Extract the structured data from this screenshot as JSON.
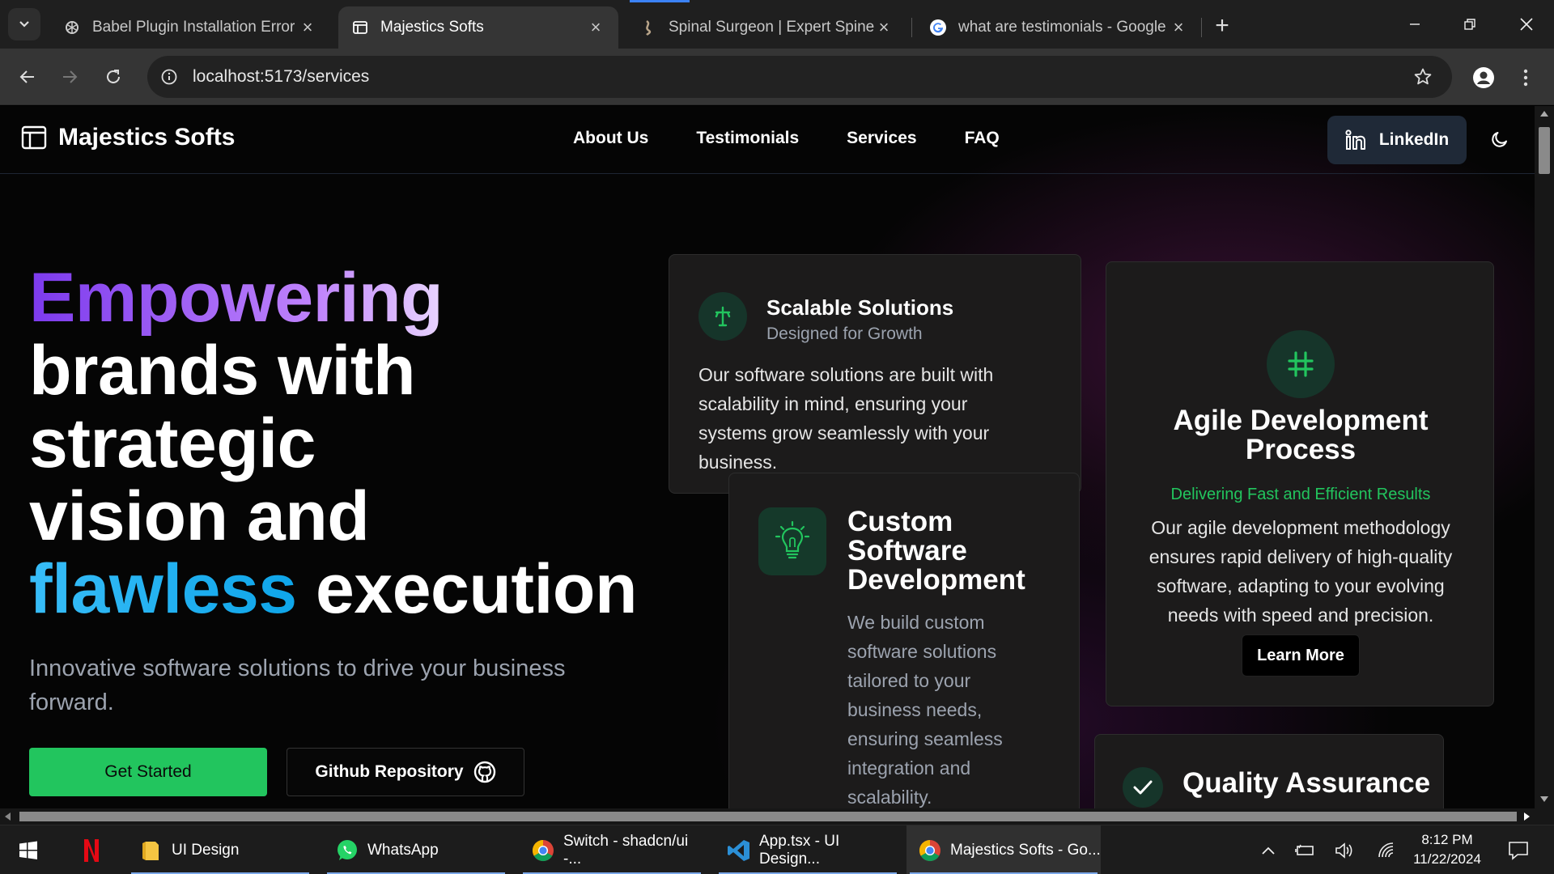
{
  "browser": {
    "tabs": [
      {
        "title": "Babel Plugin Installation Error",
        "icon": "openai-icon",
        "active": false
      },
      {
        "title": "Majestics Softs",
        "icon": "layout-icon",
        "active": true
      },
      {
        "title": "Spinal Surgeon | Expert Spine C",
        "icon": "spine-icon",
        "active": false
      },
      {
        "title": "what are testimonials - Google",
        "icon": "google-icon",
        "active": false
      }
    ],
    "url": "localhost:5173/services"
  },
  "site": {
    "brand": "Majestics Softs",
    "nav": [
      "About Us",
      "Testimonials",
      "Services",
      "FAQ"
    ],
    "linkedin_label": "LinkedIn"
  },
  "hero": {
    "line1": "Empowering",
    "line2": "brands with",
    "line3": "strategic",
    "line4": "vision and",
    "line5_highlight": "flawless",
    "line5_rest": " execution",
    "subtitle": "Innovative software solutions to drive your business forward.",
    "primary_button": "Get Started",
    "secondary_button": "Github Repository"
  },
  "cards": {
    "scalable": {
      "title": "Scalable Solutions",
      "subtitle": "Designed for Growth",
      "body": "Our software solutions are built with scalability in mind, ensuring your systems grow seamlessly with your business."
    },
    "custom": {
      "title": "Custom Software Development",
      "body": "We build custom software solutions tailored to your business needs, ensuring seamless integration and scalability."
    },
    "agile": {
      "title": "Agile Development Process",
      "subtitle": "Delivering Fast and Efficient Results",
      "body": "Our agile development methodology ensures rapid delivery of high-quality software, adapting to your evolving needs with speed and precision.",
      "button": "Learn More"
    },
    "quality": {
      "title": "Quality Assurance"
    }
  },
  "taskbar": {
    "items": [
      {
        "label": "",
        "icon": "netflix-icon"
      },
      {
        "label": "UI Design",
        "icon": "folder-icon"
      },
      {
        "label": "WhatsApp",
        "icon": "whatsapp-icon"
      },
      {
        "label": "Switch - shadcn/ui -...",
        "icon": "chrome-icon"
      },
      {
        "label": "App.tsx - UI Design...",
        "icon": "vscode-icon"
      },
      {
        "label": "Majestics Softs - Go...",
        "icon": "chrome-icon"
      }
    ],
    "time": "8:12 PM",
    "date": "11/22/2024"
  },
  "colors": {
    "accent_green": "#22c55e",
    "purple": "#7c3aed",
    "blue": "#38bdf8",
    "linkedin_bg": "#1f2937"
  }
}
